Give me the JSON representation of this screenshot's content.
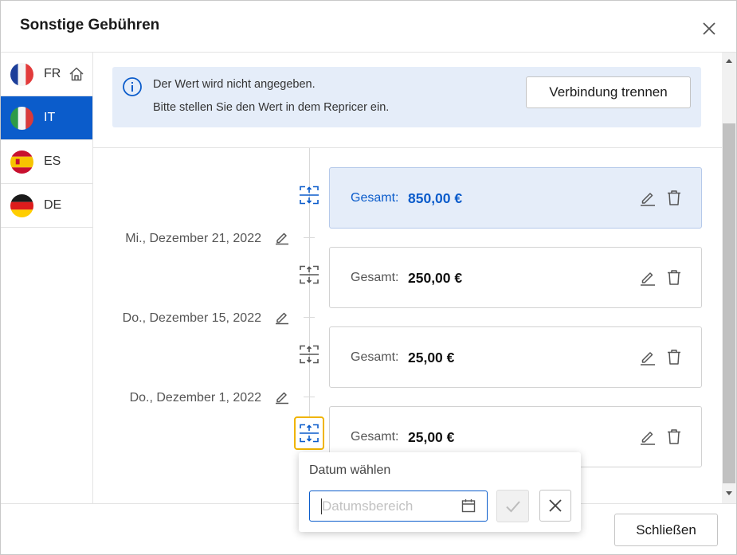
{
  "dialog": {
    "title": "Sonstige Gebühren"
  },
  "sidebar": {
    "countries": [
      {
        "code": "FR",
        "active": false,
        "home": true
      },
      {
        "code": "IT",
        "active": true,
        "home": false
      },
      {
        "code": "ES",
        "active": false,
        "home": false
      },
      {
        "code": "DE",
        "active": false,
        "home": false
      }
    ]
  },
  "info": {
    "line1": "Der Wert wird nicht angegeben.",
    "line2": "Bitte stellen Sie den Wert in dem Repricer ein.",
    "disconnect_label": "Verbindung trennen"
  },
  "timeline": {
    "dates": [
      "Mi., Dezember 21, 2022",
      "Do., Dezember 15, 2022",
      "Do., Dezember 1, 2022"
    ],
    "entries": [
      {
        "label": "Gesamt:",
        "amount": "850,00 €",
        "selected": true
      },
      {
        "label": "Gesamt:",
        "amount": "250,00 €",
        "selected": false
      },
      {
        "label": "Gesamt:",
        "amount": "25,00 €",
        "selected": false
      },
      {
        "label": "Gesamt:",
        "amount": "25,00 €",
        "selected": false
      }
    ]
  },
  "popup": {
    "title": "Datum wählen",
    "date_placeholder": "Datumsbereich",
    "date_value": ""
  },
  "footer": {
    "close_label": "Schließen"
  },
  "colors": {
    "accent": "#0b5ccb",
    "info_bg": "#e5edf9",
    "focus_outline": "#f0b400"
  },
  "icons": {
    "close": "close-icon",
    "home": "home-icon",
    "info": "info-icon",
    "edit": "pencil-icon",
    "delete": "trash-icon",
    "split": "split-timeline-icon",
    "calendar": "calendar-icon",
    "confirm": "check-icon",
    "cancel": "close-icon"
  }
}
